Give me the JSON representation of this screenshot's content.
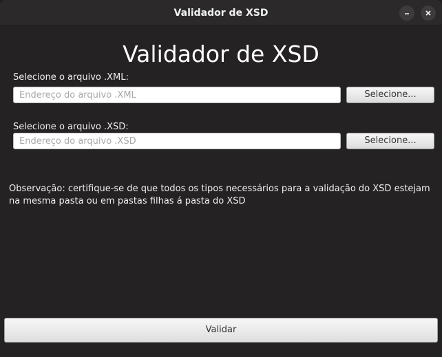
{
  "window": {
    "title": "Validador de XSD",
    "minimize_icon": "minimize-icon",
    "close_icon": "close-icon"
  },
  "main": {
    "heading": "Validador de XSD",
    "xml": {
      "label": "Selecione o arquivo .XML:",
      "placeholder": "Endereço do arquivo .XML",
      "value": "",
      "button_label": "Selecione..."
    },
    "xsd": {
      "label": "Selecione o arquivo .XSD:",
      "placeholder": "Endereço do arquivo .XSD",
      "value": "",
      "button_label": "Selecione..."
    },
    "note": "Observação: certifique-se de que todos os tipos necessários para a validação do XSD estejam na mesma pasta ou em pastas filhas á pasta do XSD",
    "validate_label": "Validar"
  },
  "colors": {
    "background": "#242222",
    "titlebar": "#2b2929",
    "text": "#f0f0f0",
    "button": "#e8e8e8"
  }
}
